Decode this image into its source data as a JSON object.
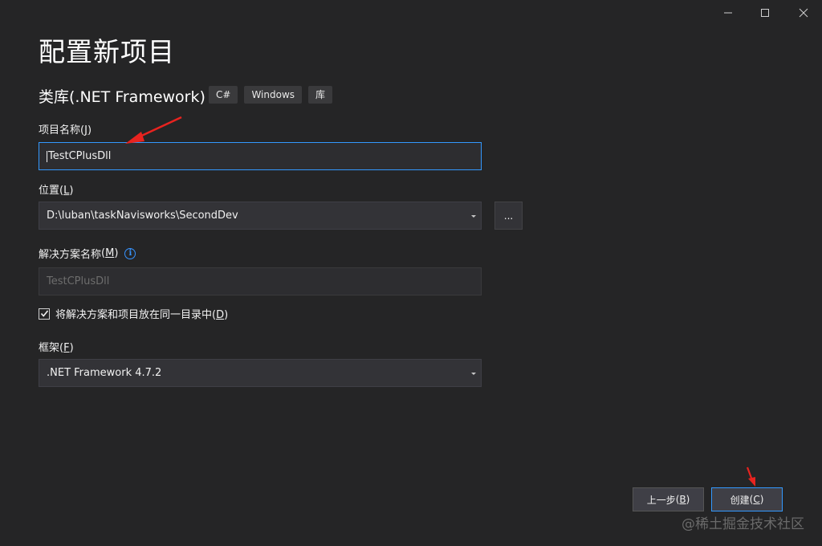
{
  "window": {
    "minimize_glyph": "—",
    "maximize_glyph": "☐",
    "close_glyph": "✕"
  },
  "header": {
    "title": "配置新项目",
    "subtitle": "类库(.NET Framework)",
    "tags": [
      "C#",
      "Windows",
      "库"
    ]
  },
  "project_name": {
    "label": "项目名称",
    "hotkey": "J",
    "value": "TestCPlusDll"
  },
  "location": {
    "label": "位置",
    "hotkey": "L",
    "value": "D:\\luban\\taskNavisworks\\SecondDev",
    "browse_label": "..."
  },
  "solution_name": {
    "label": "解决方案名称",
    "hotkey": "M",
    "placeholder": "TestCPlusDll",
    "info_glyph": "i"
  },
  "same_dir": {
    "label": "将解决方案和项目放在同一目录中",
    "hotkey": "D",
    "checked": true
  },
  "framework": {
    "label": "框架",
    "hotkey": "F",
    "value": ".NET Framework 4.7.2"
  },
  "footer": {
    "back_label": "上一步",
    "back_hotkey": "B",
    "create_label": "创建",
    "create_hotkey": "C"
  },
  "watermark": "@稀土掘金技术社区",
  "colors": {
    "background": "#252526",
    "accent": "#3399ff",
    "annotation_arrow": "#e8231f"
  },
  "icons": {
    "minimize": "minimize-icon",
    "maximize": "maximize-icon",
    "close": "close-icon",
    "dropdown": "chevron-down-icon",
    "info": "info-icon",
    "check": "check-icon",
    "annotation": "arrow-annotation-icon"
  }
}
